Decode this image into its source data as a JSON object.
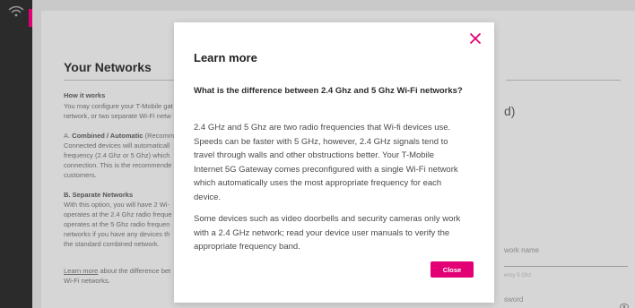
{
  "background": {
    "section_title": "Your Networks",
    "how_heading": "How it works",
    "how_line1": "You may configure your T-Mobile gat",
    "how_line2": "network, or two separate Wi-Fi netw",
    "a_prefix": "A. ",
    "a_bold": "Combined / Automatic",
    "a_rest": " (Recomm",
    "a_line2": "Connected devices will automaticall",
    "a_line3": "frequency (2.4 Ghz or 5 Ghz) which",
    "a_line4": "connection. This is the recommende",
    "a_line5": "customers.",
    "b_heading": "B. Separate Networks",
    "b_line1": "With this option, you will have 2 Wi-",
    "b_line2": "operates at the 2.4 Ghz radio freque",
    "b_line3": "operates at the 5 Ghz radio frequen",
    "b_line4": "networks if you have any devices th",
    "b_line5": "the standard combined network.",
    "learn_link": "Learn more",
    "learn_rest": " about the difference bet",
    "learn_line2": "Wi-Fi networks.",
    "right_fragment": "d)",
    "network_name_label": "work name",
    "network_hint": "ency 5 Ghz",
    "password_label": "sword"
  },
  "modal": {
    "title": "Learn more",
    "question": "What is the difference between 2.4 Ghz and 5 Ghz Wi-Fi networks?",
    "paragraph1": "2.4 GHz and 5 Ghz are two radio frequencies that Wi-fi devices use. Speeds can be faster with 5 GHz, however, 2.4 GHz signals tend to travel through walls and other obstructions better. Your T-Mobile Internet 5G Gateway comes preconfigured with a single Wi-Fi network which automatically uses the most appropriate frequency for each device.",
    "paragraph2": "Some devices such as video doorbells and security cameras only work with a 2.4 GHz network; read your device user manuals to verify the appropriate frequency band.",
    "close_button": "Close"
  },
  "icons": {
    "rail_icon": "wifi-icon",
    "modal_close": "close-icon",
    "password_toggle": "eye-icon"
  },
  "colors": {
    "accent": "#e20074",
    "rail": "#2b2b2b"
  }
}
